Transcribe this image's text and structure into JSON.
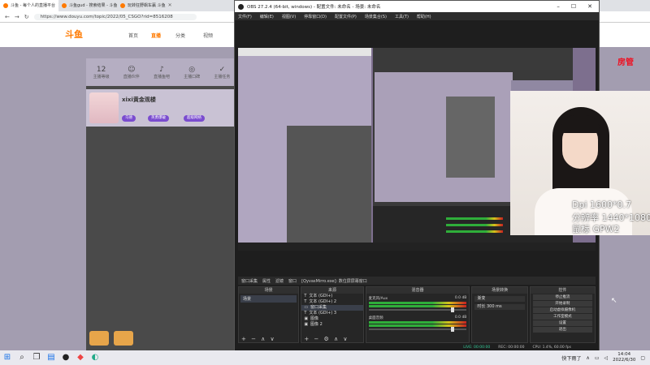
{
  "browser": {
    "tabs": [
      {
        "label": "斗鱼 - 每个人的直播平台",
        "active": true
      },
      {
        "label": "斗鱼gud - 搜索结果 - 斗鱼直播",
        "active": false
      },
      {
        "label": "玩转狂野飙车赢 斗鱼",
        "active": false
      }
    ],
    "url": "https://www.douyu.com/topic/2022/05_CSGO?rid=8516208",
    "logo": "斗鱼",
    "nav": [
      "首页",
      "直播",
      "分类",
      "视频"
    ],
    "icons": [
      {
        "value": "12",
        "label": "主播等级"
      },
      {
        "value": "☺",
        "label": "直播伙伴"
      },
      {
        "value": "♪",
        "label": "直播鱼吧"
      },
      {
        "value": "◎",
        "label": "主播口碑"
      },
      {
        "value": "✓",
        "label": "主播任务"
      }
    ],
    "streamer_name": "xixi黄金观楼",
    "pills": [
      "乌德",
      "英勇爆破",
      "超级网络"
    ],
    "right_logo": "房管"
  },
  "obs": {
    "title": "OBS 27.2.4 (64-bit, windows) - 配置文件: 未命名 - 场景: 未命名",
    "menu": [
      "文件(F)",
      "编辑(E)",
      "视图(V)",
      "停靠窗口(D)",
      "配置文件(P)",
      "场景集合(S)",
      "工具(T)",
      "帮助(H)"
    ],
    "overlay": [
      "Dpi 1600*0.7",
      "分辨率 1440*1080",
      "鼠标 GPW2"
    ],
    "dock_bar": {
      "source": "窗口采集",
      "props": "属性",
      "filters": "滤镜",
      "window": "窗口",
      "window_value": "[QyvasMirro.exe]: 数位屏屏幕窗口"
    },
    "panels": {
      "scenes": {
        "title": "场景",
        "items": [
          "场景"
        ]
      },
      "sources": {
        "title": "来源",
        "items": [
          "文本 (GDI+)",
          "文本 (GDI+) 2",
          "窗口采集",
          "文本 (GDI+) 3",
          "图像",
          "图像 2"
        ]
      },
      "mixer": {
        "title": "混音器",
        "channels": [
          {
            "name": "麦克风/Aux",
            "db": "0.0 dB"
          },
          {
            "name": "桌面音频",
            "db": "0.0 dB"
          }
        ]
      },
      "transitions": {
        "title": "场景转换",
        "type": "渐变",
        "duration_label": "时长",
        "duration": "300 ms"
      },
      "controls": {
        "title": "控件",
        "buttons": [
          "停止推流",
          "开始录制",
          "启动虚拟摄像机",
          "工作室模式",
          "设置",
          "退出"
        ]
      }
    },
    "status": {
      "live": "LIVE: 00:00:00",
      "rec": "REC: 00:00:00",
      "cpu": "CPU: 1.4%, 60.00 fps"
    }
  },
  "taskbar": {
    "weather": "快下雨了",
    "time": "14:04",
    "date": "2022/6/30"
  }
}
